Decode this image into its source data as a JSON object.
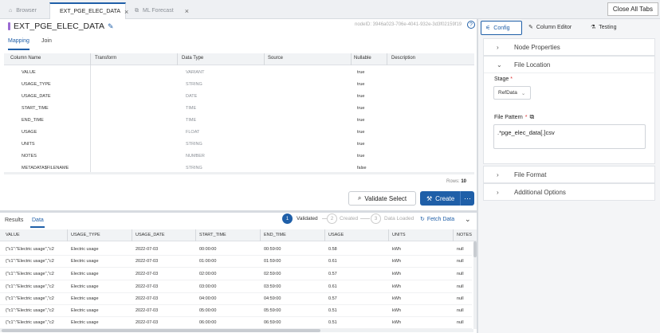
{
  "tabs": [
    {
      "label": "Browser",
      "icon": "home-icon"
    },
    {
      "label": "EXT_PGE_ELEC_DATA",
      "icon": "table-icon"
    },
    {
      "label": "ML Forecast",
      "icon": "ml-icon"
    }
  ],
  "close_all_label": "Close All Tabs",
  "node": {
    "title": "EXT_PGE_ELEC_DATA",
    "id_text": "nodeID: 3946a023-706e-4041-932e-3d3f02159f19"
  },
  "subtabs": [
    "Mapping",
    "Join"
  ],
  "mapping": {
    "headers": [
      "Column Name",
      "Transform",
      "Data Type",
      "Source",
      "Nullable",
      "Description"
    ],
    "rows": [
      {
        "name": "VALUE",
        "type": "VARIANT",
        "nullable": "true"
      },
      {
        "name": "USAGE_TYPE",
        "type": "STRING",
        "nullable": "true"
      },
      {
        "name": "USAGE_DATE",
        "type": "DATE",
        "nullable": "true"
      },
      {
        "name": "START_TIME",
        "type": "TIME",
        "nullable": "true"
      },
      {
        "name": "END_TIME",
        "type": "TIME",
        "nullable": "true"
      },
      {
        "name": "USAGE",
        "type": "FLOAT",
        "nullable": "true"
      },
      {
        "name": "UNITS",
        "type": "STRING",
        "nullable": "true"
      },
      {
        "name": "NOTES",
        "type": "NUMBER",
        "nullable": "true"
      },
      {
        "name": "METADATA$FILENAME",
        "type": "STRING",
        "nullable": "false"
      }
    ],
    "rows_label": "Rows:",
    "rows_count": "10"
  },
  "validate_label": "Validate Select",
  "create_label": "Create",
  "results": {
    "tabs": [
      "Results",
      "Data"
    ],
    "steps": [
      {
        "num": "1",
        "label": "Validated"
      },
      {
        "num": "2",
        "label": "Created"
      },
      {
        "num": "3",
        "label": "Data Loaded"
      }
    ],
    "fetch_label": "Fetch Data",
    "headers": [
      "VALUE",
      "USAGE_TYPE",
      "USAGE_DATE",
      "START_TIME",
      "END_TIME",
      "USAGE",
      "UNITS",
      "NOTES"
    ],
    "rows": [
      [
        "{\"c1\":\"Electric usage\",\"c2",
        "Electric usage",
        "2022-07-03",
        "00:00:00",
        "00:59:00",
        "0.58",
        "kWh",
        "null"
      ],
      [
        "{\"c1\":\"Electric usage\",\"c2",
        "Electric usage",
        "2022-07-03",
        "01:00:00",
        "01:59:00",
        "0.61",
        "kWh",
        "null"
      ],
      [
        "{\"c1\":\"Electric usage\",\"c2",
        "Electric usage",
        "2022-07-03",
        "02:00:00",
        "02:59:00",
        "0.57",
        "kWh",
        "null"
      ],
      [
        "{\"c1\":\"Electric usage\",\"c2",
        "Electric usage",
        "2022-07-03",
        "03:00:00",
        "03:59:00",
        "0.61",
        "kWh",
        "null"
      ],
      [
        "{\"c1\":\"Electric usage\",\"c2",
        "Electric usage",
        "2022-07-03",
        "04:00:00",
        "04:59:00",
        "0.57",
        "kWh",
        "null"
      ],
      [
        "{\"c1\":\"Electric usage\",\"c2",
        "Electric usage",
        "2022-07-03",
        "05:00:00",
        "05:59:00",
        "0.51",
        "kWh",
        "null"
      ],
      [
        "{\"c1\":\"Electric usage\",\"c2",
        "Electric usage",
        "2022-07-03",
        "06:00:00",
        "06:59:00",
        "0.51",
        "kWh",
        "null"
      ]
    ]
  },
  "right_tabs": [
    "Config",
    "Column Editor",
    "Testing"
  ],
  "panels": {
    "node_properties": "Node Properties",
    "file_location": "File Location",
    "stage_label": "Stage",
    "stage_value": "RefData",
    "file_pattern_label": "File Pattern",
    "file_pattern_value": ".*pge_elec_data[.]csv",
    "file_format": "File Format",
    "additional_options": "Additional Options"
  },
  "colors": {
    "accent": "#1f5fa8",
    "node_purple": "#9b6bd3",
    "required": "#d33333"
  }
}
